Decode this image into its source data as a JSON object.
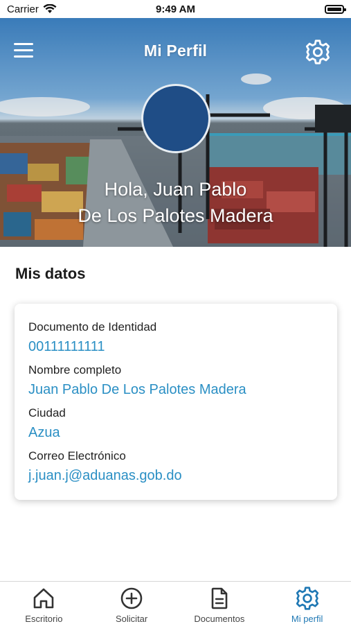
{
  "status_bar": {
    "carrier": "Carrier",
    "time": "9:49 AM",
    "icons": [
      "wifi-icon",
      "battery-icon"
    ]
  },
  "header": {
    "title": "Mi Perfil",
    "menu_icon": "menu-icon",
    "settings_icon": "gear-icon"
  },
  "profile": {
    "greeting_line1": "Hola, Juan Pablo",
    "greeting_line2": "De Los Palotes Madera",
    "avatar_color": "#1f4d86"
  },
  "section": {
    "title": "Mis datos"
  },
  "fields": [
    {
      "label": "Documento de Identidad",
      "value": "00111111111"
    },
    {
      "label": "Nombre completo",
      "value": "Juan Pablo De Los Palotes Madera"
    },
    {
      "label": "Ciudad",
      "value": "Azua"
    },
    {
      "label": "Correo Electrónico",
      "value": "j.juan.j@aduanas.gob.do"
    }
  ],
  "tabs": [
    {
      "label": "Escritorio",
      "icon": "home-icon",
      "active": false
    },
    {
      "label": "Solicitar",
      "icon": "plus-circle-icon",
      "active": false
    },
    {
      "label": "Documentos",
      "icon": "document-icon",
      "active": false
    },
    {
      "label": "Mi perfil",
      "icon": "gear-icon",
      "active": true
    }
  ],
  "colors": {
    "accent": "#2a8fc4",
    "active_tab": "#1f78b4",
    "avatar": "#1f4d86"
  }
}
